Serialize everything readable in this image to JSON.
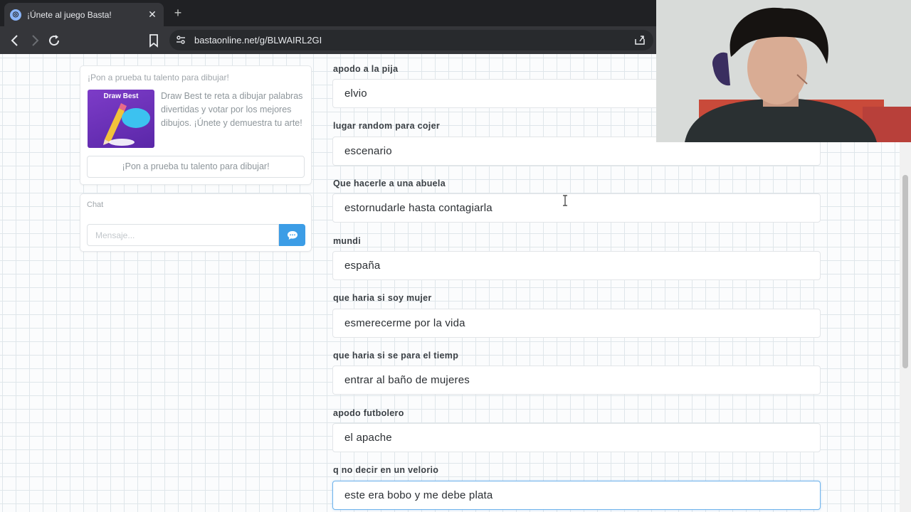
{
  "browser": {
    "tab_title": "¡Únete al juego Basta!",
    "tab_close": "✕",
    "new_tab": "+",
    "url": "bastaonline.net/g/BLWAIRL2GI"
  },
  "promo": {
    "heading": "¡Pon a prueba tu talento para dibujar!",
    "image_title": "Draw Best",
    "description": "Draw Best te reta a dibujar palabras divertidas y votar por los mejores dibujos. ¡Únete y demuestra tu arte!",
    "button_label": "¡Pon a prueba tu talento para dibujar!"
  },
  "chat": {
    "title": "Chat",
    "placeholder": "Mensaje..."
  },
  "fields": [
    {
      "label": "apodo a la pija",
      "value": "elvio"
    },
    {
      "label": "lugar random para cojer",
      "value": "escenario"
    },
    {
      "label": "Que hacerle a una abuela",
      "value": "estornudarle hasta contagiarla"
    },
    {
      "label": "mundi",
      "value": "españa"
    },
    {
      "label": "que haria si soy mujer",
      "value": "esmerecerme por la vida"
    },
    {
      "label": "que haria si se para el tiemp",
      "value": "entrar al baño de mujeres"
    },
    {
      "label": "apodo futbolero",
      "value": "el apache"
    },
    {
      "label": "q no decir en un velorio",
      "value": "este era bobo y me debe plata"
    }
  ],
  "colors": {
    "accent": "#3c9de6",
    "active_border": "#6fb3ec"
  }
}
